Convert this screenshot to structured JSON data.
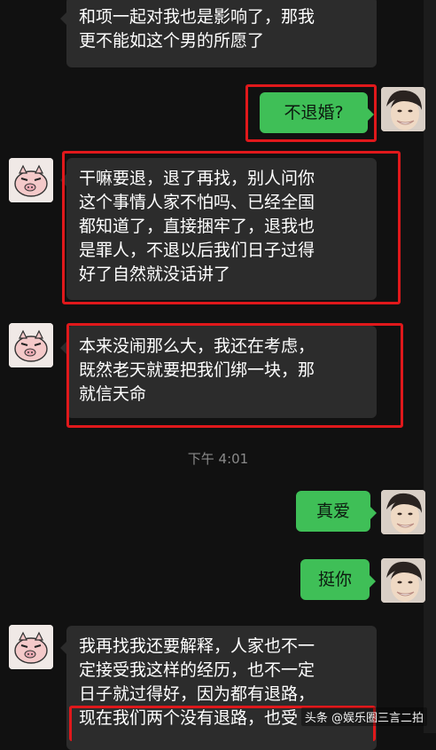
{
  "messages": [
    {
      "side": "in",
      "text": "和项一起对我也是影响了，那我\n更不能如这个男的所愿了"
    },
    {
      "side": "out",
      "text": "不退婚?"
    },
    {
      "side": "in",
      "text": "干嘛要退，退了再找，别人问你\n这个事情人家不怕吗、已经全国\n都知道了，直接捆牢了，退我也\n是罪人，不退以后我们日子过得\n好了自然就没话讲了"
    },
    {
      "side": "in",
      "text": "本来没闹那么大，我还在考虑，\n既然老天就要把我们绑一块，那\n就信天命"
    },
    {
      "side": "out",
      "text": "真爱"
    },
    {
      "side": "out",
      "text": "挺你"
    },
    {
      "side": "in",
      "text": "我再找我还要解释，人家也不一\n定接受我这样的经历，也不一定\n日子就过得好，因为都有退路，\n现在我们两个没有退路，也受"
    }
  ],
  "timestamp": "下午 4:01",
  "watermark": "头条 @娱乐圈三言二拍",
  "colors": {
    "background": "#111111",
    "incoming_bubble": "#2c2c2c",
    "outgoing_bubble": "#3fbf57",
    "highlight": "#e0181b"
  }
}
